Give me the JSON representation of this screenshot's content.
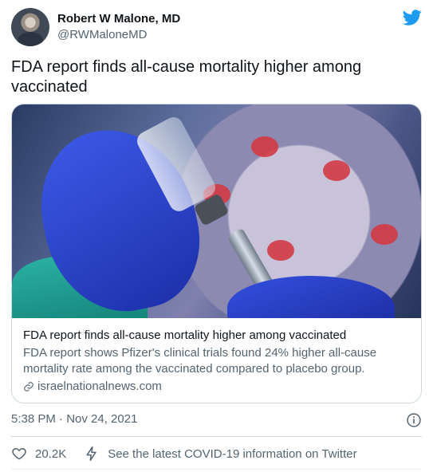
{
  "author": {
    "display_name": "Robert W Malone, MD",
    "handle": "@RWMaloneMD"
  },
  "tweet": {
    "text": "FDA report finds all-cause mortality higher among vaccinated"
  },
  "card": {
    "title": "FDA report finds all-cause mortality higher among vaccinated",
    "description": "FDA report shows Pfizer's clinical trials found 24% higher all-cause mortality rate among the vaccinated compared to placebo group.",
    "domain": "israelnationalnews.com"
  },
  "meta": {
    "timestamp": "5:38 PM · Nov 24, 2021"
  },
  "actions": {
    "like_count": "20.2K",
    "covid_link": "See the latest COVID-19 information on Twitter"
  },
  "colors": {
    "twitter_blue": "#1d9bf0",
    "text_primary": "#0f1419",
    "text_secondary": "#536471",
    "border": "#cfd9de"
  },
  "icons": [
    "twitter-bird-icon",
    "link-icon",
    "info-icon",
    "heart-icon",
    "lightning-bolt-icon"
  ]
}
